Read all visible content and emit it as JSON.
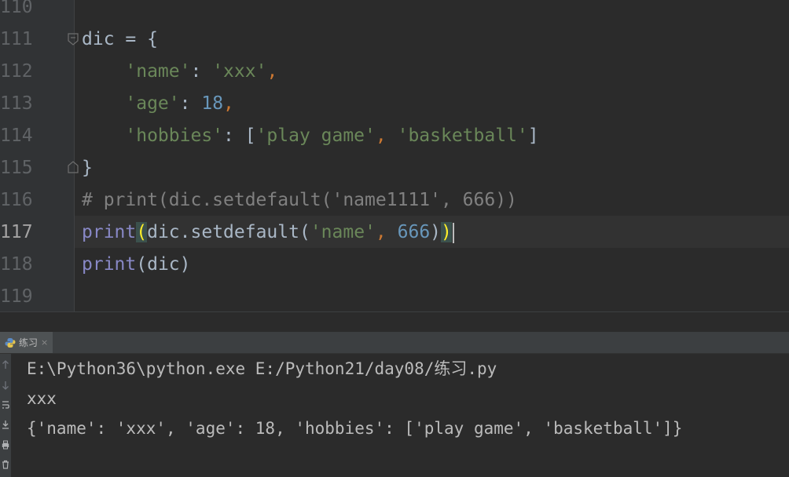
{
  "editor": {
    "line_numbers": [
      "110",
      "111",
      "112",
      "113",
      "114",
      "115",
      "116",
      "117",
      "118",
      "119"
    ],
    "current_line": "117",
    "lines": [
      {
        "segments": []
      },
      {
        "segments": [
          {
            "t": "dic = {",
            "c": "s-br"
          }
        ]
      },
      {
        "segments": [
          {
            "t": "    ",
            "c": "s-br"
          },
          {
            "t": "'name'",
            "c": "s-str"
          },
          {
            "t": ": ",
            "c": "s-br"
          },
          {
            "t": "'xxx'",
            "c": "s-str"
          },
          {
            "t": ",",
            "c": "s-kw"
          }
        ]
      },
      {
        "segments": [
          {
            "t": "    ",
            "c": "s-br"
          },
          {
            "t": "'age'",
            "c": "s-str"
          },
          {
            "t": ": ",
            "c": "s-br"
          },
          {
            "t": "18",
            "c": "s-num"
          },
          {
            "t": ",",
            "c": "s-kw"
          }
        ]
      },
      {
        "segments": [
          {
            "t": "    ",
            "c": "s-br"
          },
          {
            "t": "'hobbies'",
            "c": "s-str"
          },
          {
            "t": ": [",
            "c": "s-br"
          },
          {
            "t": "'play game'",
            "c": "s-str"
          },
          {
            "t": ", ",
            "c": "s-kw"
          },
          {
            "t": "'basketball'",
            "c": "s-str"
          },
          {
            "t": "]",
            "c": "s-br"
          }
        ]
      },
      {
        "segments": [
          {
            "t": "}",
            "c": "s-br"
          }
        ]
      },
      {
        "segments": [
          {
            "t": "# print(dic.setdefault('name1111', 666))",
            "c": "s-cm"
          }
        ]
      },
      {
        "segments": [
          {
            "t": "print",
            "c": "s-fn"
          },
          {
            "t": "(",
            "c": "brace-match"
          },
          {
            "t": "dic.setdefault(",
            "c": "s-br"
          },
          {
            "t": "'name'",
            "c": "s-str"
          },
          {
            "t": ", ",
            "c": "s-kw"
          },
          {
            "t": "666",
            "c": "s-num"
          },
          {
            "t": ")",
            "c": "s-br"
          },
          {
            "t": ")",
            "c": "brace-match"
          }
        ]
      },
      {
        "segments": [
          {
            "t": "print",
            "c": "s-fn"
          },
          {
            "t": "(dic)",
            "c": "s-br"
          }
        ]
      },
      {
        "segments": []
      }
    ]
  },
  "run_panel": {
    "tab_label": "练习",
    "tab_close": "×",
    "tab_icon": "python-icon",
    "toolbar_icons": [
      "arrow-up-icon",
      "arrow-down-icon",
      "soft-wrap-icon",
      "scroll-to-end-icon",
      "print-icon",
      "trash-icon"
    ]
  },
  "console": {
    "lines": [
      "E:\\Python36\\python.exe E:/Python21/day08/练习.py",
      "xxx",
      "{'name': 'xxx', 'age': 18, 'hobbies': ['play game', 'basketball']}"
    ]
  },
  "colors": {
    "background": "#2b2b2b",
    "gutter": "#313335",
    "string": "#6a8759",
    "number": "#6897bb",
    "keyword": "#cc7832",
    "builtin": "#8888c6",
    "comment": "#808080",
    "brace_match": "#ffef28"
  }
}
